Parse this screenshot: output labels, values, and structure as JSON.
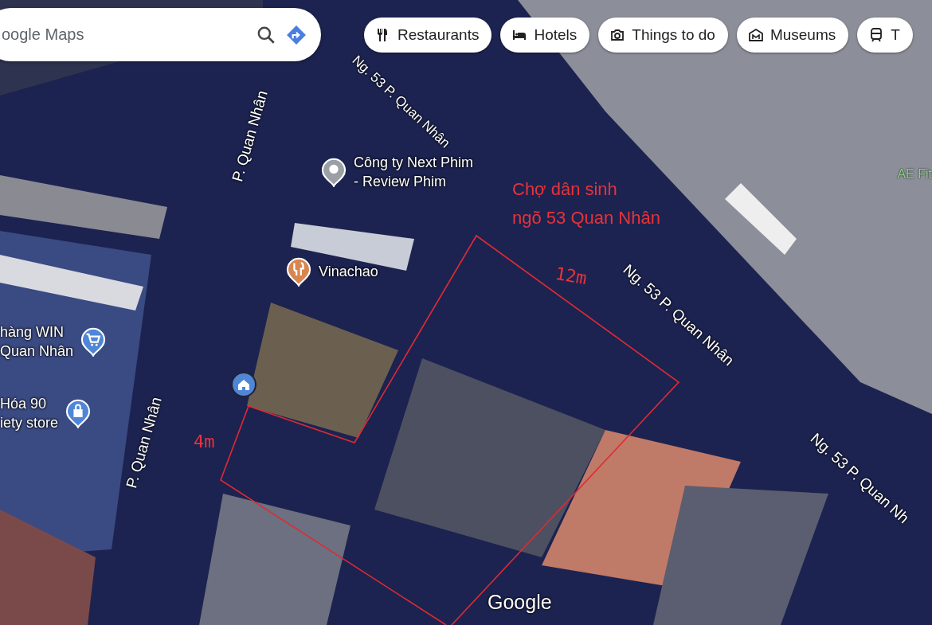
{
  "search": {
    "placeholder": "oogle Maps"
  },
  "chips": [
    {
      "kind": "restaurant",
      "label": "Restaurants"
    },
    {
      "kind": "hotel",
      "label": "Hotels"
    },
    {
      "kind": "camera",
      "label": "Things to do"
    },
    {
      "kind": "museum",
      "label": "Museums"
    },
    {
      "kind": "transit",
      "label": "T"
    }
  ],
  "street_labels": [
    "Ng. 53 P. Quan Nhân",
    "P. Quan Nhân",
    "P. Quan Nhân",
    "Ng. 53 P. Quan Nhân",
    "Ng. 53 P. Quan Nh"
  ],
  "places": [
    {
      "kind": "generic",
      "lines": [
        "Công ty Next Phim",
        "- Review Phim"
      ]
    },
    {
      "kind": "restaurant",
      "lines": [
        "Vinachao"
      ]
    },
    {
      "kind": "shopping",
      "lines": [
        "hàng WIN",
        "Quan Nhân"
      ]
    },
    {
      "kind": "store",
      "lines": [
        "Hóa 90",
        "iety store"
      ]
    },
    {
      "kind": "home"
    }
  ],
  "business_label": "AE Fit",
  "annotations": {
    "title_lines": [
      "Chợ dân sinh",
      "ngõ 53 Quan Nhân"
    ],
    "lengths": [
      "12m",
      "4m"
    ]
  },
  "logo": "Google"
}
